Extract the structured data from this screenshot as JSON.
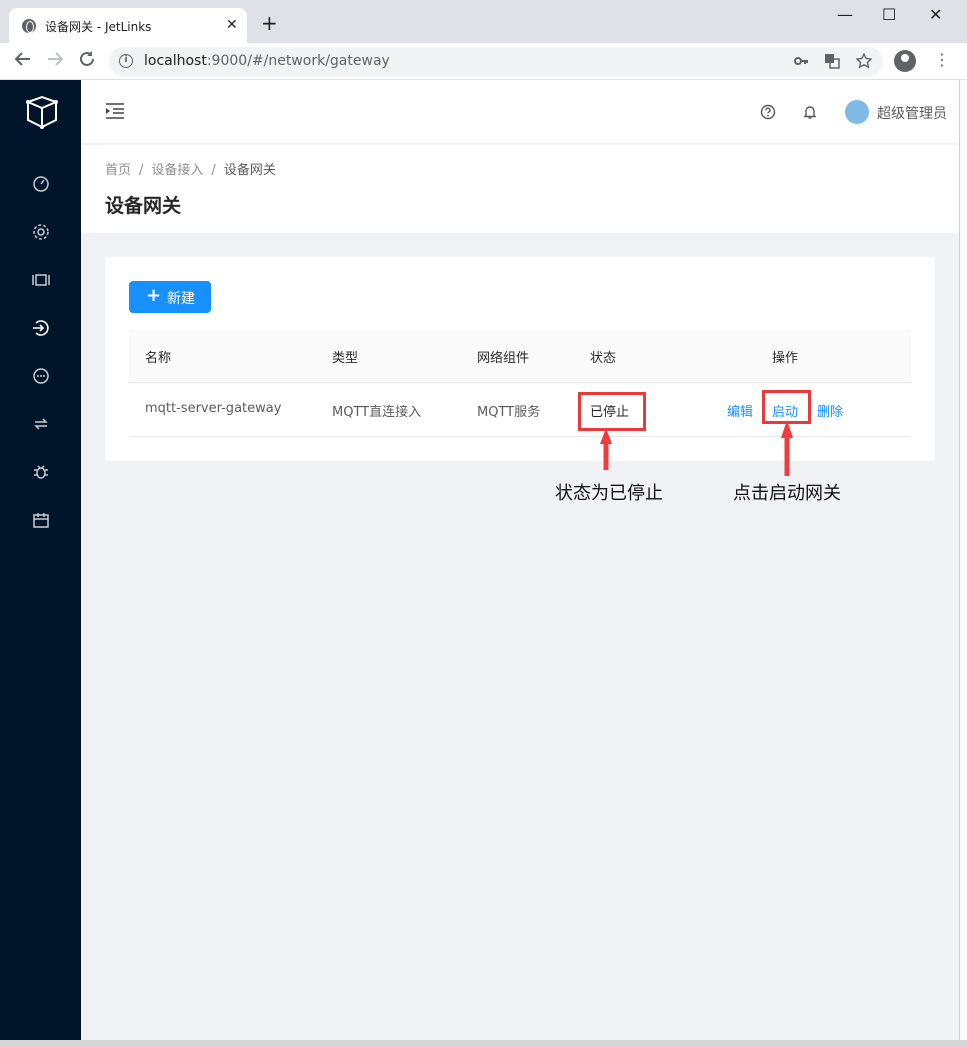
{
  "browser": {
    "tab_title": "设备网关 - JetLinks",
    "tab_close": "✕",
    "new_tab": "+",
    "win_min": "—",
    "win_max": "☐",
    "win_close": "✕",
    "url_host": "localhost",
    "url_rest": ":9000/#/network/gateway",
    "icons": [
      "back-icon",
      "forward-icon",
      "reload-icon",
      "info-icon",
      "key-icon",
      "translate-icon",
      "star-icon",
      "profile-icon",
      "menu-icon"
    ]
  },
  "sidebar": {
    "icons": [
      "dashboard-icon",
      "settings-icon",
      "device-icon",
      "login-icon",
      "message-icon",
      "sync-icon",
      "bug-icon",
      "calendar-icon"
    ]
  },
  "header": {
    "user_name": "超级管理员"
  },
  "breadcrumb": {
    "items": [
      "首页",
      "设备接入",
      "设备网关"
    ],
    "separator": "/"
  },
  "page_title": "设备网关",
  "toolbar": {
    "new_label": "新建",
    "new_icon": "+"
  },
  "table": {
    "columns": [
      "名称",
      "类型",
      "网络组件",
      "状态",
      "操作"
    ],
    "rows": [
      {
        "name": "mqtt-server-gateway",
        "type": "MQTT直连接入",
        "network": "MQTT服务",
        "status": "已停止",
        "actions": [
          "编辑",
          "启动",
          "删除"
        ]
      }
    ]
  },
  "annotations": {
    "status_note": "状态为已停止",
    "start_note": "点击启动网关"
  },
  "colors": {
    "sidebar_bg": "#001529",
    "primary": "#1890ff",
    "annotation_red": "#e83a3a"
  }
}
